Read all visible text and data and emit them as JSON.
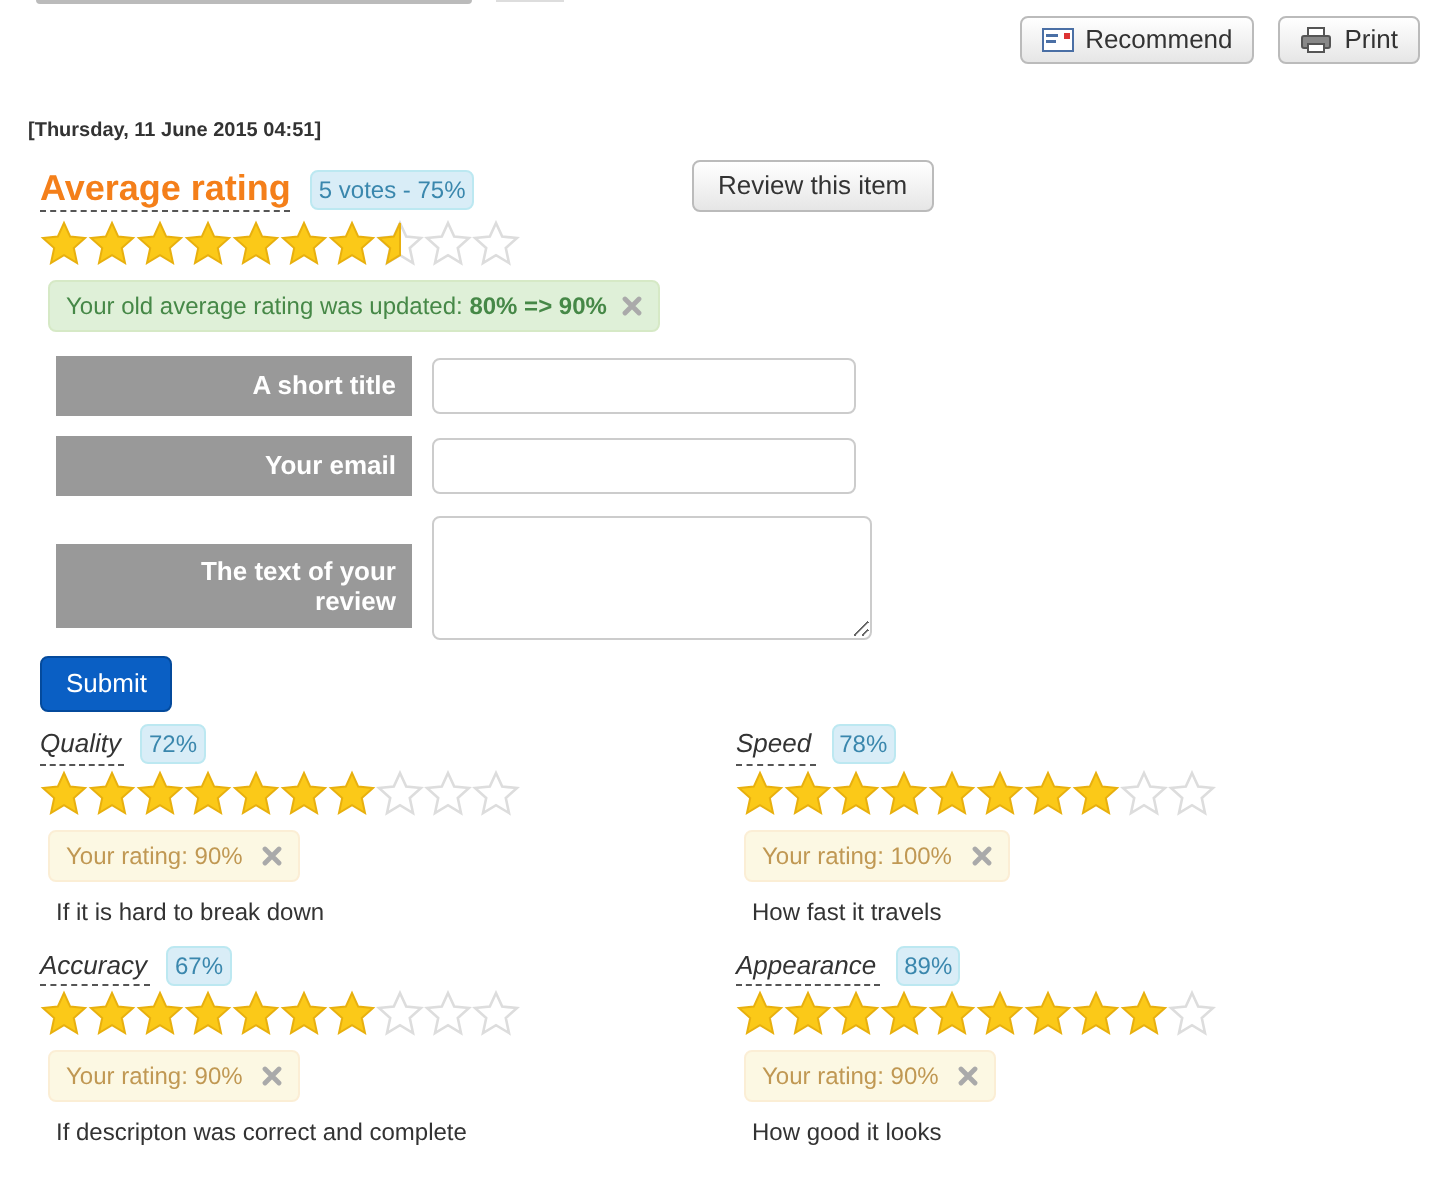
{
  "toolbar": {
    "buttons": [
      {
        "kind": "mail",
        "label": "Recommend"
      },
      {
        "kind": "print",
        "label": "Print"
      }
    ]
  },
  "date": "[Thursday, 11 June 2015 04:51]",
  "average": {
    "title": "Average rating",
    "votes": "5 votes - 75%",
    "stars": 7.5,
    "review_button": "Review this item",
    "notice": "Your old average rating was updated: **80% => 90%**"
  },
  "form": {
    "fields": [
      {
        "label": "A short title",
        "kind": "input"
      },
      {
        "label": "Your email",
        "kind": "input"
      },
      {
        "label": "The text of your review",
        "kind": "textarea"
      }
    ],
    "submit": "Submit"
  },
  "criteria": [
    {
      "name": "Quality",
      "percent": "72%",
      "stars": 7,
      "your_rating": "Your rating: 90%",
      "description": "If it is hard to break down"
    },
    {
      "name": "Speed",
      "percent": "78%",
      "stars": 8,
      "your_rating": "Your rating: 100%",
      "description": "How fast it travels"
    },
    {
      "name": "Accuracy",
      "percent": "67%",
      "stars": 7,
      "your_rating": "Your rating: 90%",
      "description": "If descripton was correct and complete"
    },
    {
      "name": "Appearance",
      "percent": "89%",
      "stars": 9,
      "your_rating": "Your rating: 90%",
      "description": "How good it looks"
    }
  ]
}
